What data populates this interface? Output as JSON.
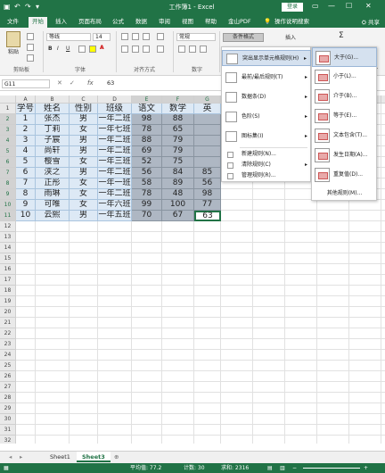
{
  "titlebar": {
    "title": "工作簿1 - Excel",
    "login": "登录",
    "min": "—",
    "restore": "☐",
    "close": "✕"
  },
  "tabs": {
    "items": [
      "文件",
      "开始",
      "插入",
      "页面布局",
      "公式",
      "数据",
      "审阅",
      "视图",
      "帮助",
      "金山PDF"
    ],
    "active_index": 1,
    "search": "操作说明搜索",
    "share": "共享"
  },
  "ribbon": {
    "paste": "粘贴",
    "clipboard": "剪贴板",
    "font_name": "等线",
    "font_size": "14",
    "font_group": "字体",
    "align_group": "对齐方式",
    "number_format": "常规",
    "number_group": "数字",
    "conditional_format": "条件格式",
    "insert": "插入",
    "sum": "Σ"
  },
  "formula_bar": {
    "name_box": "G11",
    "fx": "fx",
    "value": "63"
  },
  "grid": {
    "columns": [
      "A",
      "B",
      "C",
      "D",
      "E",
      "F",
      "G"
    ],
    "rows": [
      "1",
      "2",
      "3",
      "4",
      "5",
      "6",
      "7",
      "8",
      "9",
      "10",
      "11",
      "12",
      "13",
      "14",
      "15",
      "16",
      "17",
      "18",
      "19",
      "20",
      "21",
      "22",
      "23",
      "24",
      "25",
      "26",
      "27",
      "28",
      "29",
      "30",
      "31",
      "32"
    ],
    "data": [
      [
        "学号",
        "姓名",
        "性别",
        "班级",
        "语文",
        "数学",
        "英"
      ],
      [
        "1",
        "张杰",
        "男",
        "一年二班",
        "98",
        "88",
        ""
      ],
      [
        "2",
        "丁莉",
        "女",
        "一年七班",
        "78",
        "65",
        ""
      ],
      [
        "3",
        "子宸",
        "男",
        "一年二班",
        "88",
        "79",
        ""
      ],
      [
        "4",
        "尚轩",
        "男",
        "一年二班",
        "69",
        "79",
        ""
      ],
      [
        "5",
        "樱雪",
        "女",
        "一年三班",
        "52",
        "75",
        ""
      ],
      [
        "6",
        "浃之",
        "男",
        "一年二班",
        "56",
        "84",
        "85"
      ],
      [
        "7",
        "正彤",
        "女",
        "一年一班",
        "58",
        "89",
        "56"
      ],
      [
        "8",
        "雨琳",
        "女",
        "一年二班",
        "78",
        "48",
        "98"
      ],
      [
        "9",
        "可唯",
        "女",
        "一年六班",
        "99",
        "100",
        "77"
      ],
      [
        "10",
        "云熙",
        "男",
        "一年五班",
        "70",
        "67",
        "63"
      ]
    ]
  },
  "cf_menu": {
    "items": [
      {
        "label": "突出显示单元格规则(H)",
        "icon": "highlight-rules-icon"
      },
      {
        "label": "最前/最后规则(T)",
        "icon": "top-bottom-rules-icon"
      },
      {
        "label": "数据条(D)",
        "icon": "data-bars-icon"
      },
      {
        "label": "色阶(S)",
        "icon": "color-scales-icon"
      },
      {
        "label": "图标集(I)",
        "icon": "icon-sets-icon"
      }
    ],
    "bottom": [
      {
        "label": "新建规则(N)...",
        "icon": "new-rule-icon"
      },
      {
        "label": "清除规则(C)",
        "icon": "clear-rules-icon"
      },
      {
        "label": "管理规则(R)...",
        "icon": "manage-rules-icon"
      }
    ]
  },
  "submenu": {
    "items": [
      "大于(G)...",
      "小于(L)...",
      "介于(B)...",
      "等于(E)...",
      "文本包含(T)...",
      "发生日期(A)...",
      "重复值(D)..."
    ],
    "more": "其他规则(M)..."
  },
  "sheets": {
    "tabs": [
      "Sheet1",
      "Sheet3"
    ],
    "active_index": 1,
    "add": "⊕"
  },
  "status": {
    "average": "平均值: 77.2",
    "count": "计数: 30",
    "sum": "求和: 2316"
  },
  "colors": {
    "excel_green": "#217346",
    "selection_gray": "#aeb7c3",
    "selection_blue": "#dde9f5",
    "menu_highlight": "#d5e1ef"
  }
}
